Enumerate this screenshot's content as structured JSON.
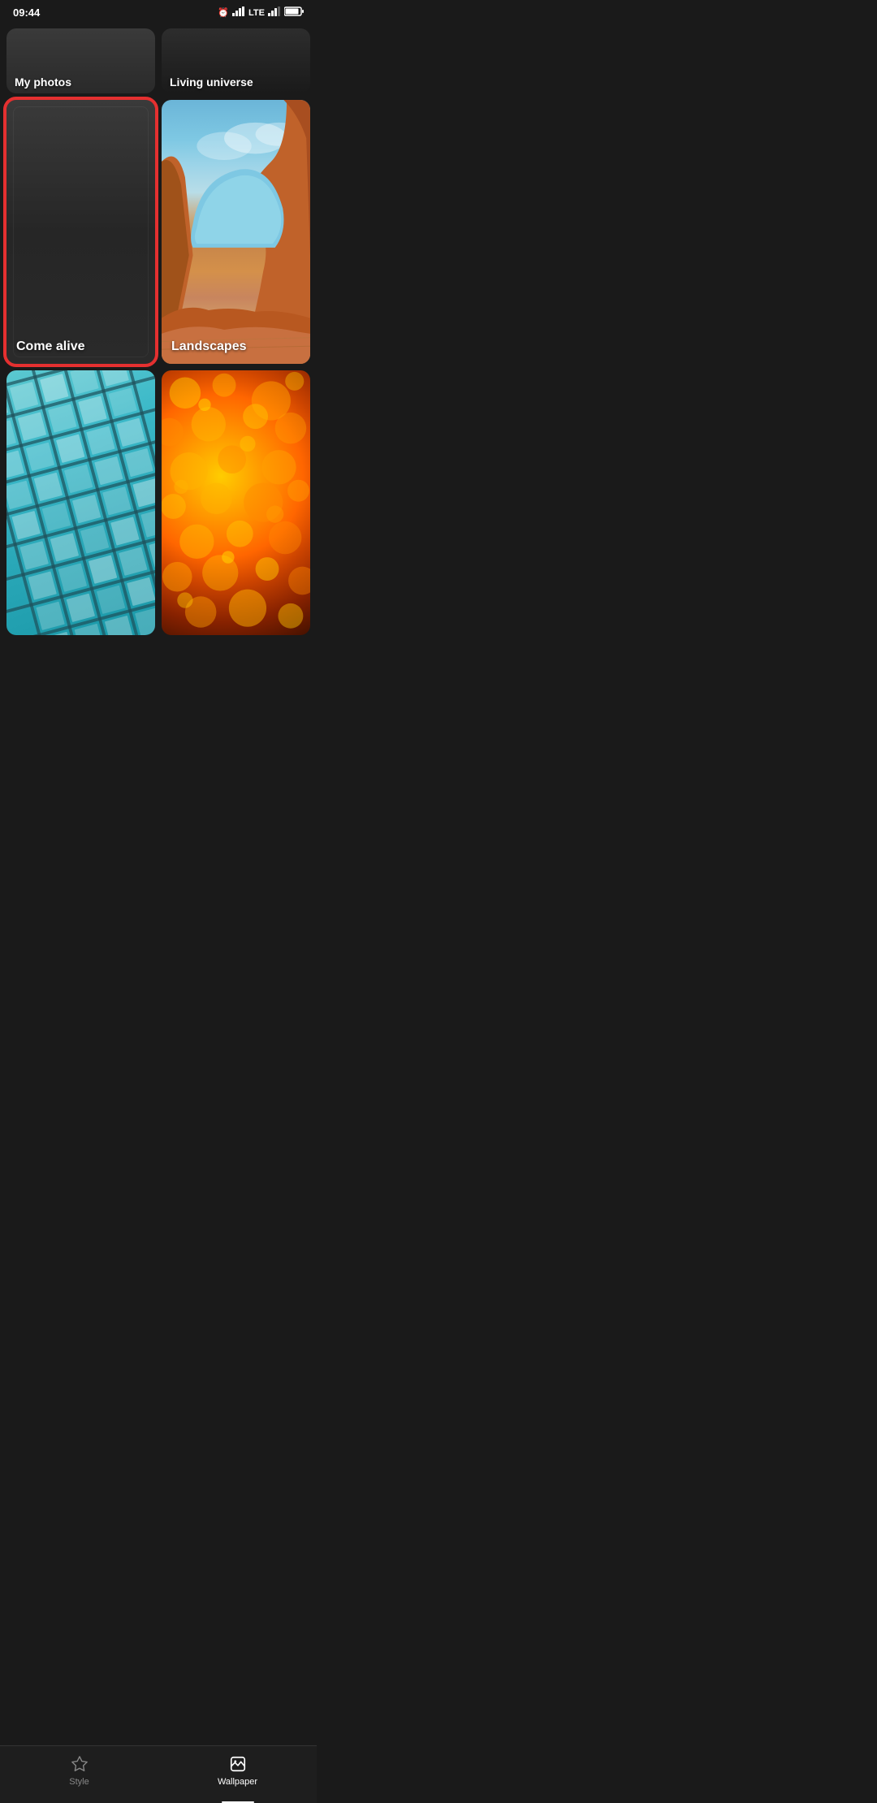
{
  "status_bar": {
    "time": "09:44",
    "alarm_icon": "⏰",
    "signal_bars": "|||",
    "network": "LTE",
    "battery": "▮▮▮"
  },
  "categories": [
    {
      "id": "my-photos",
      "label": "My photos",
      "position": "top-left",
      "partial": true,
      "selected": false
    },
    {
      "id": "living-universe",
      "label": "Living universe",
      "position": "top-right",
      "partial": true,
      "selected": false
    },
    {
      "id": "come-alive",
      "label": "Come alive",
      "position": "mid-left",
      "partial": false,
      "selected": true
    },
    {
      "id": "landscapes",
      "label": "Landscapes",
      "position": "mid-right",
      "partial": false,
      "selected": false
    },
    {
      "id": "geometric",
      "label": "",
      "position": "bottom-left",
      "partial": false,
      "selected": false
    },
    {
      "id": "bokeh",
      "label": "",
      "position": "bottom-right",
      "partial": false,
      "selected": false
    }
  ],
  "bottom_nav": {
    "items": [
      {
        "id": "style",
        "label": "Style",
        "active": false
      },
      {
        "id": "wallpaper",
        "label": "Wallpaper",
        "active": true
      }
    ]
  }
}
